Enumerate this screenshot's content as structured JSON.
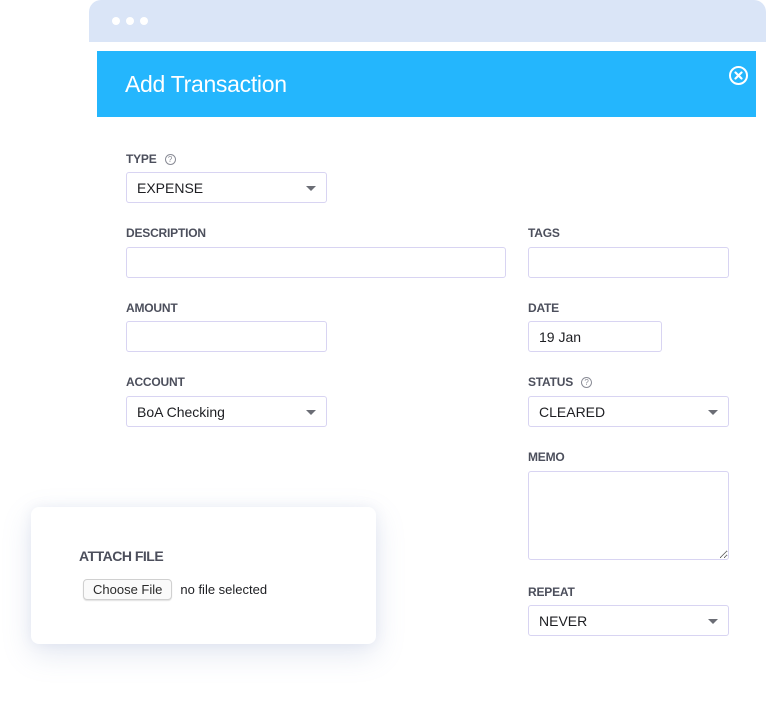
{
  "window": {
    "dots": 3
  },
  "header": {
    "title": "Add Transaction",
    "close_icon": "close-circle-icon",
    "color": "#24b6fd"
  },
  "form": {
    "type": {
      "label": "TYPE",
      "help_icon": "help-circle-icon",
      "value": "EXPENSE"
    },
    "description": {
      "label": "DESCRIPTION",
      "value": "",
      "placeholder": ""
    },
    "tags": {
      "label": "TAGS",
      "value": "",
      "placeholder": ""
    },
    "amount": {
      "label": "AMOUNT",
      "value": "",
      "placeholder": ""
    },
    "date": {
      "label": "DATE",
      "value": "19 Jan"
    },
    "account": {
      "label": "ACCOUNT",
      "value": "BoA Checking"
    },
    "status": {
      "label": "STATUS",
      "help_icon": "help-circle-icon",
      "value": "CLEARED"
    },
    "memo": {
      "label": "MEMO",
      "value": ""
    },
    "repeat": {
      "label": "REPEAT",
      "value": "NEVER"
    }
  },
  "attach": {
    "label": "ATTACH FILE",
    "button_label": "Choose File",
    "status_text": "no file selected"
  }
}
